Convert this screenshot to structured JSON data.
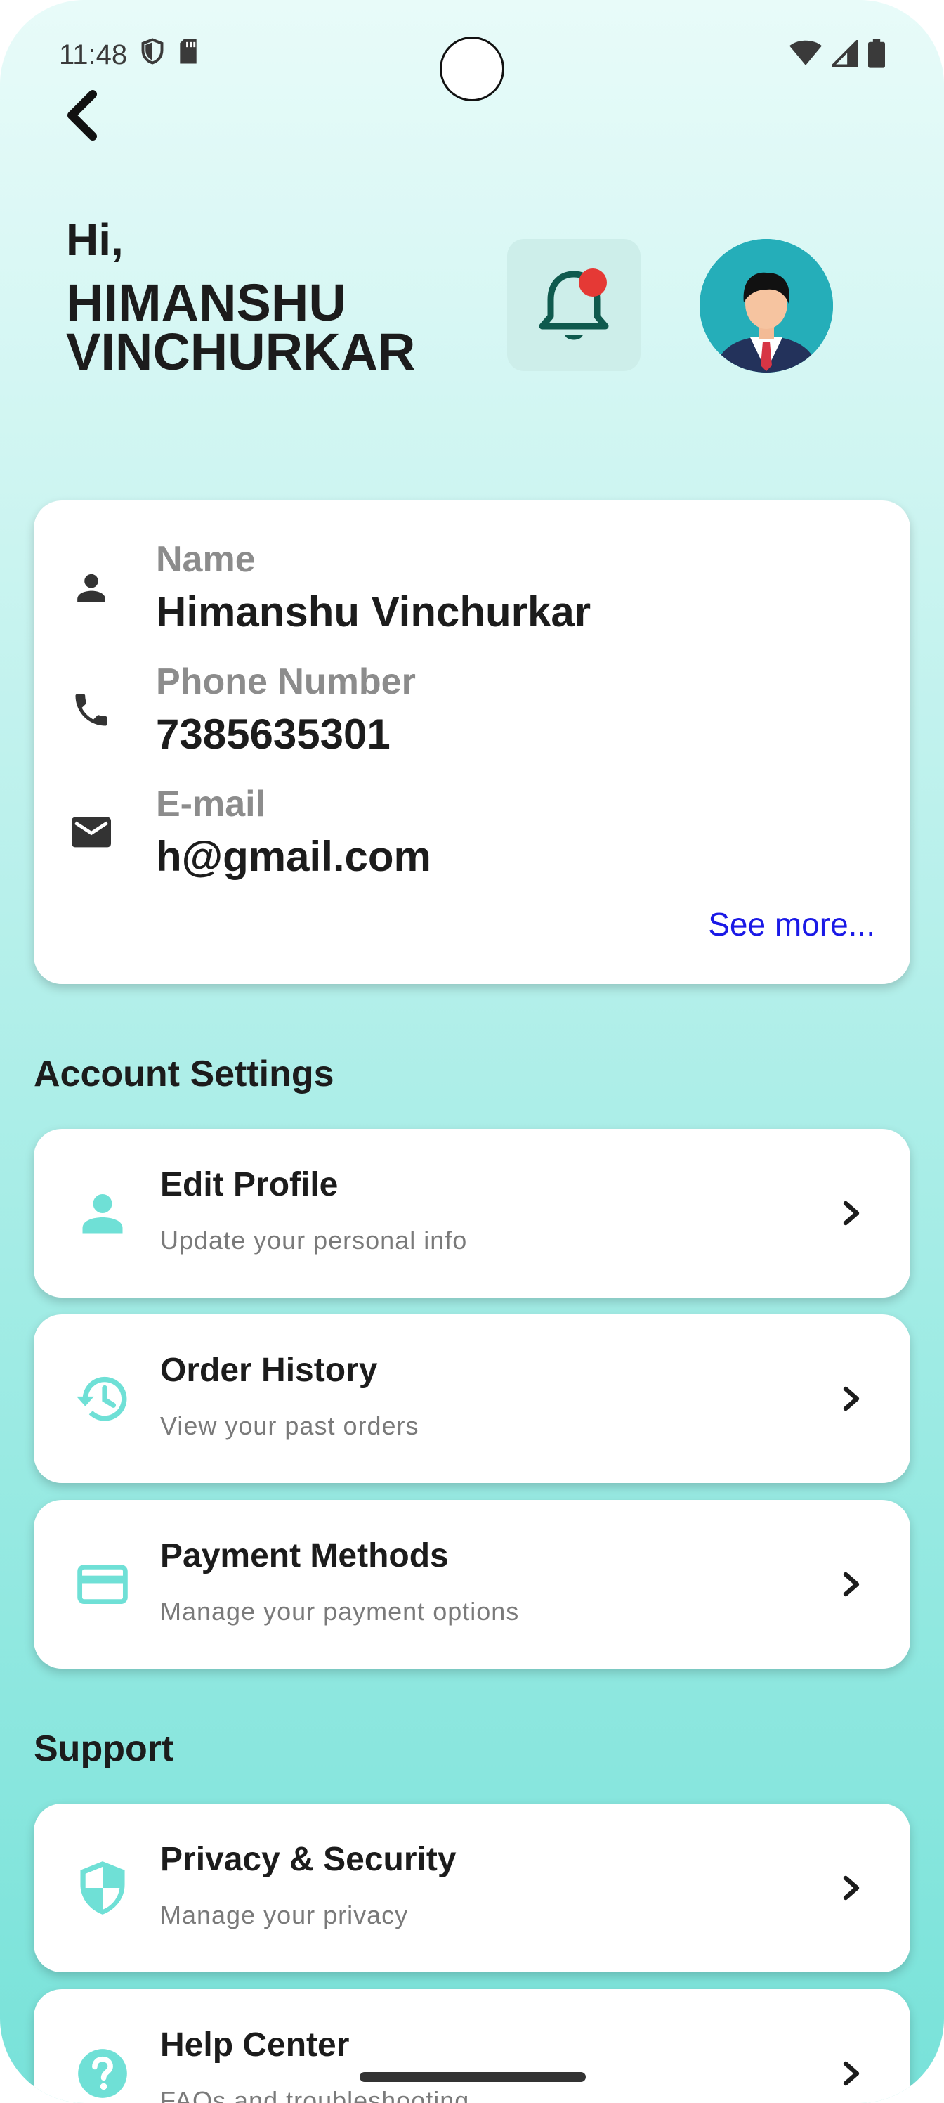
{
  "status_bar": {
    "time": "11:48"
  },
  "header": {
    "greeting": "Hi,",
    "user_name": "HIMANSHU VINCHURKAR"
  },
  "profile_card": {
    "name_label": "Name",
    "name_value": "Himanshu Vinchurkar",
    "phone_label": "Phone Number",
    "phone_value": "7385635301",
    "email_label": "E-mail",
    "email_value": "h@gmail.com",
    "see_more": "See more..."
  },
  "account_settings": {
    "title": "Account Settings",
    "items": [
      {
        "title": "Edit Profile",
        "subtitle": "Update your personal info",
        "icon": "person-icon"
      },
      {
        "title": "Order History",
        "subtitle": "View your past orders",
        "icon": "history-icon"
      },
      {
        "title": "Payment Methods",
        "subtitle": "Manage your payment options",
        "icon": "credit-card-icon"
      }
    ]
  },
  "support": {
    "title": "Support",
    "items": [
      {
        "title": "Privacy & Security",
        "subtitle": "Manage your privacy",
        "icon": "shield-icon"
      },
      {
        "title": "Help Center",
        "subtitle": "FAQs and troubleshooting",
        "icon": "help-icon"
      }
    ]
  },
  "colors": {
    "accent": "#6fe0d6",
    "link": "#1a19e6",
    "notification_dot": "#e53935",
    "bell": "#0f5a4e"
  }
}
